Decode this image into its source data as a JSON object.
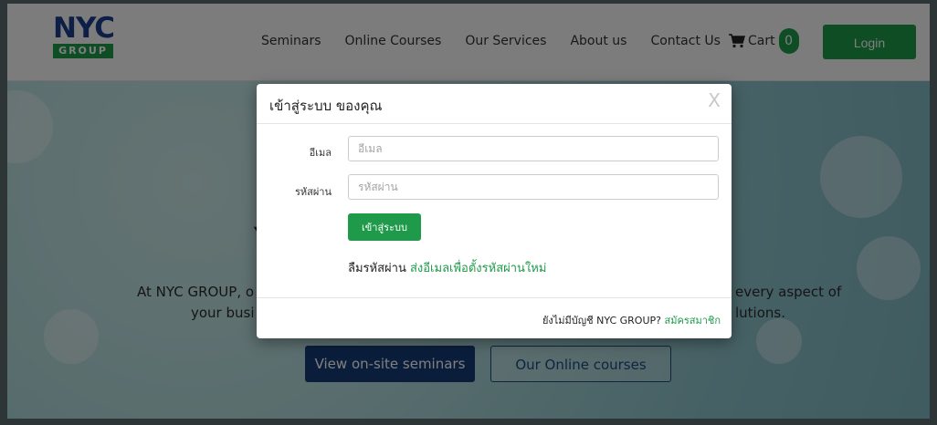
{
  "navbar": {
    "logo_top": "NYC",
    "logo_bottom": "GROUP",
    "menu": [
      "Seminars",
      "Online Courses",
      "Our Services",
      "About us",
      "Contact Us"
    ],
    "cart_label": "Cart",
    "cart_count": "0",
    "login_label": "Login"
  },
  "hero": {
    "heading_partial": "Y",
    "line1_left": "At NYC GROUP, o",
    "line1_right": "every aspect of",
    "line2_left": "your busi",
    "line2_right": "lutions.",
    "btn_seminars": "View on-site seminars",
    "btn_online": "Our Online courses"
  },
  "modal": {
    "title": "เข้าสู่ระบบ ของคุณ",
    "close": "X",
    "email_label": "อีเมล",
    "email_placeholder": "อีเมล",
    "password_label": "รหัสผ่าน",
    "password_placeholder": "รหัสผ่าน",
    "submit_label": "เข้าสู่ระบบ",
    "forgot_text": "ลืมรหัสผ่าน",
    "forgot_link": "ส่งอีเมลเพื่อตั้งรหัสผ่านใหม่",
    "footer_text": "ยังไม่มีบัญชี NYC GROUP?",
    "footer_link": "สมัครสมาชิก"
  },
  "colors": {
    "brand_green": "#1e9a4a",
    "brand_blue": "#1a3f8f",
    "seminar_button": "#143d79"
  }
}
